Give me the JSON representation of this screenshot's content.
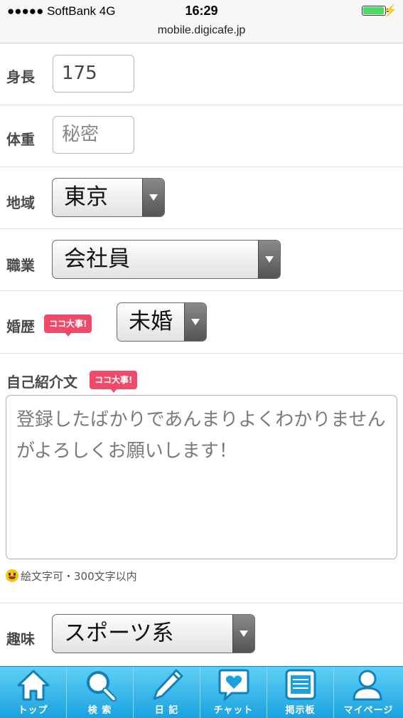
{
  "status": {
    "carrier": "●●●●● SoftBank   4G",
    "time": "16:29",
    "bolt": "⚡"
  },
  "url": "mobile.digicafe.jp",
  "form": {
    "height": {
      "label": "身長",
      "value": "175"
    },
    "weight": {
      "label": "体重",
      "placeholder": "秘密"
    },
    "region": {
      "label": "地域",
      "selected": "東京"
    },
    "job": {
      "label": "職業",
      "selected": "会社員"
    },
    "marriage": {
      "label": "婚歴",
      "badge": "ココ大事!",
      "selected": "未婚"
    },
    "intro": {
      "label": "自己紹介文",
      "badge": "ココ大事!",
      "placeholder": "登録したばかりであんまりよくわかりませんがよろしくお願いします！",
      "note": "絵文字可・300文字以内"
    },
    "hobby": {
      "label": "趣味",
      "selected": "スポーツ系"
    }
  },
  "tabbar": [
    {
      "label": "トップ",
      "icon": "home-icon"
    },
    {
      "label": "検 索",
      "icon": "search-icon"
    },
    {
      "label": "日 記",
      "icon": "pencil-icon"
    },
    {
      "label": "チャット",
      "icon": "chat-heart-icon"
    },
    {
      "label": "掲示板",
      "icon": "board-icon"
    },
    {
      "label": "マイページ",
      "icon": "user-icon"
    }
  ],
  "colors": {
    "tabbar": "#1aa2e0",
    "badge": "#f04a6a",
    "battery": "#4cd964"
  }
}
